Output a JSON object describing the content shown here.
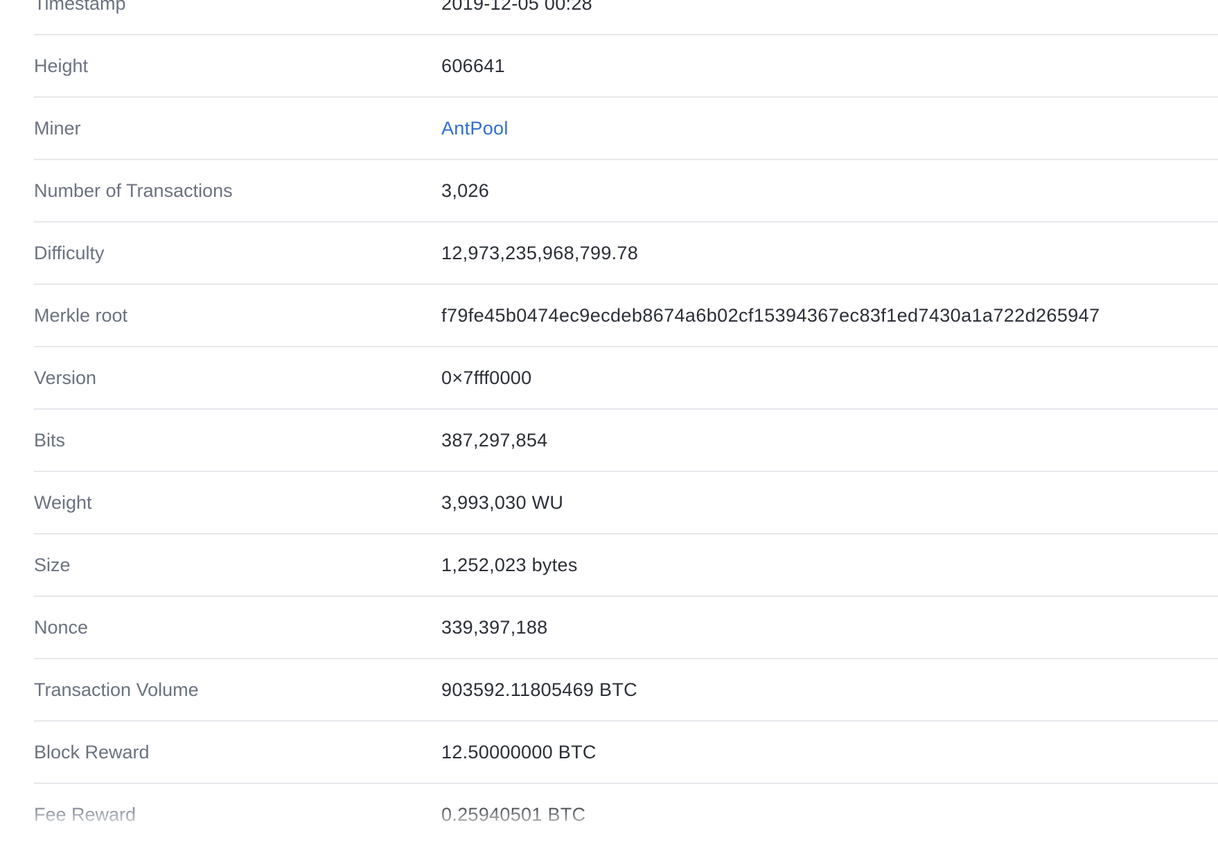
{
  "block_details": {
    "rows": [
      {
        "label": "Timestamp",
        "value": "2019-12-05 00:28"
      },
      {
        "label": "Height",
        "value": "606641"
      },
      {
        "label": "Miner",
        "value": "AntPool"
      },
      {
        "label": "Number of Transactions",
        "value": "3,026"
      },
      {
        "label": "Difficulty",
        "value": "12,973,235,968,799.78"
      },
      {
        "label": "Merkle root",
        "value": "f79fe45b0474ec9ecdeb8674a6b02cf15394367ec83f1ed7430a1a722d265947"
      },
      {
        "label": "Version",
        "value": "0×7fff0000"
      },
      {
        "label": "Bits",
        "value": "387,297,854"
      },
      {
        "label": "Weight",
        "value": "3,993,030 WU"
      },
      {
        "label": "Size",
        "value": "1,252,023 bytes"
      },
      {
        "label": "Nonce",
        "value": "339,397,188"
      },
      {
        "label": "Transaction Volume",
        "value": "903592.11805469 BTC"
      },
      {
        "label": "Block Reward",
        "value": "12.50000000 BTC"
      },
      {
        "label": "Fee Reward",
        "value": "0.25940501 BTC"
      }
    ]
  },
  "colors": {
    "label": "#6b7280",
    "value": "#2b2f36",
    "link": "#2f6fd1",
    "divider": "#e6e8ec"
  }
}
